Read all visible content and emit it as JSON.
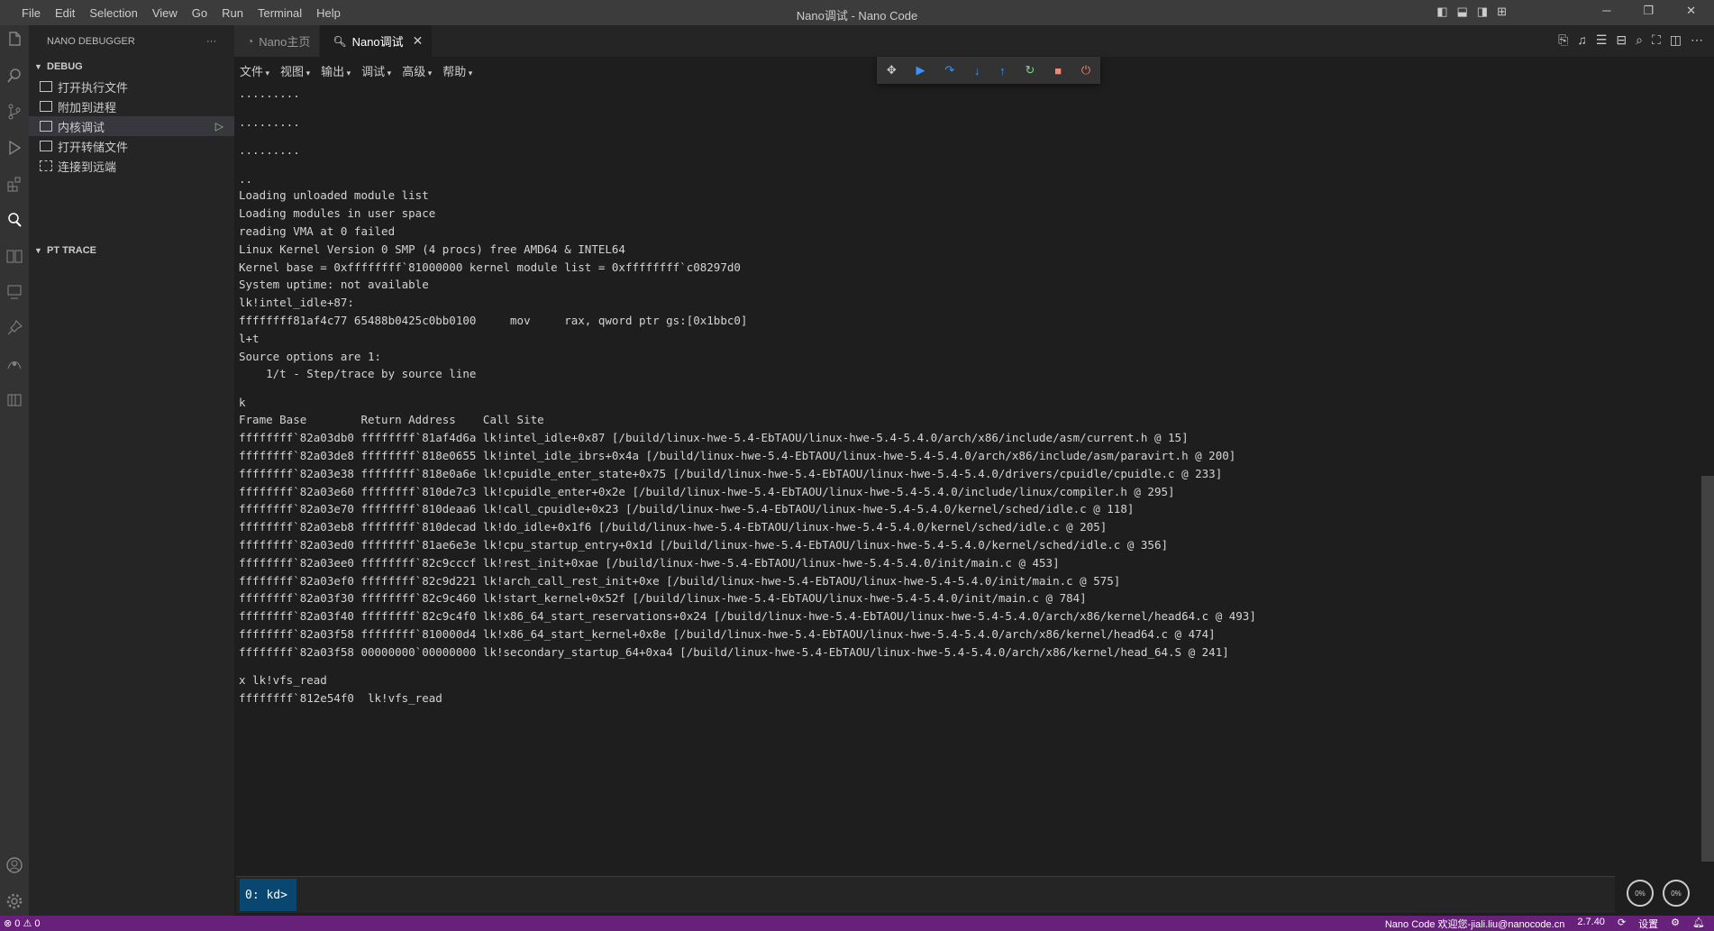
{
  "window": {
    "title": "Nano调试 - Nano Code",
    "menu": [
      "File",
      "Edit",
      "Selection",
      "View",
      "Go",
      "Run",
      "Terminal",
      "Help"
    ]
  },
  "sidebar": {
    "header": "NANO DEBUGGER",
    "more": "···",
    "debug_section": "DEBUG",
    "items": [
      "打开执行文件",
      "附加到进程",
      "内核调试",
      "打开转储文件",
      "连接到远端"
    ],
    "pt_section": "PT TRACE"
  },
  "tabs": [
    {
      "label": "Nano主页",
      "active": false
    },
    {
      "label": "Nano调试",
      "active": true
    }
  ],
  "panel_menu": [
    "文件",
    "视图",
    "输出",
    "调试",
    "高级",
    "帮助"
  ],
  "output_lines": [
    ".........",
    ".........",
    ".........",
    "..",
    "Loading unloaded module list",
    "Loading modules in user space",
    "reading VMA at 0 failed",
    "Linux Kernel Version 0 SMP (4 procs) free AMD64 & INTEL64",
    "Kernel base = 0xffffffff`81000000 kernel module list = 0xffffffff`c08297d0",
    "System uptime: not available",
    "lk!intel_idle+87:",
    "ffffffff81af4c77 65488b0425c0bb0100     mov     rax, qword ptr gs:[0x1bbc0]",
    "l+t",
    "Source options are 1:",
    "    1/t - Step/trace by source line",
    "k",
    "Frame Base        Return Address    Call Site",
    "ffffffff`82a03db0 ffffffff`81af4d6a lk!intel_idle+0x87 [/build/linux-hwe-5.4-EbTAOU/linux-hwe-5.4-5.4.0/arch/x86/include/asm/current.h @ 15]",
    "ffffffff`82a03de8 ffffffff`818e0655 lk!intel_idle_ibrs+0x4a [/build/linux-hwe-5.4-EbTAOU/linux-hwe-5.4-5.4.0/arch/x86/include/asm/paravirt.h @ 200]",
    "ffffffff`82a03e38 ffffffff`818e0a6e lk!cpuidle_enter_state+0x75 [/build/linux-hwe-5.4-EbTAOU/linux-hwe-5.4-5.4.0/drivers/cpuidle/cpuidle.c @ 233]",
    "ffffffff`82a03e60 ffffffff`810de7c3 lk!cpuidle_enter+0x2e [/build/linux-hwe-5.4-EbTAOU/linux-hwe-5.4-5.4.0/include/linux/compiler.h @ 295]",
    "ffffffff`82a03e70 ffffffff`810deaa6 lk!call_cpuidle+0x23 [/build/linux-hwe-5.4-EbTAOU/linux-hwe-5.4-5.4.0/kernel/sched/idle.c @ 118]",
    "ffffffff`82a03eb8 ffffffff`810decad lk!do_idle+0x1f6 [/build/linux-hwe-5.4-EbTAOU/linux-hwe-5.4-5.4.0/kernel/sched/idle.c @ 205]",
    "ffffffff`82a03ed0 ffffffff`81ae6e3e lk!cpu_startup_entry+0x1d [/build/linux-hwe-5.4-EbTAOU/linux-hwe-5.4-5.4.0/kernel/sched/idle.c @ 356]",
    "ffffffff`82a03ee0 ffffffff`82c9cccf lk!rest_init+0xae [/build/linux-hwe-5.4-EbTAOU/linux-hwe-5.4-5.4.0/init/main.c @ 453]",
    "ffffffff`82a03ef0 ffffffff`82c9d221 lk!arch_call_rest_init+0xe [/build/linux-hwe-5.4-EbTAOU/linux-hwe-5.4-5.4.0/init/main.c @ 575]",
    "ffffffff`82a03f30 ffffffff`82c9c460 lk!start_kernel+0x52f [/build/linux-hwe-5.4-EbTAOU/linux-hwe-5.4-5.4.0/init/main.c @ 784]",
    "ffffffff`82a03f40 ffffffff`82c9c4f0 lk!x86_64_start_reservations+0x24 [/build/linux-hwe-5.4-EbTAOU/linux-hwe-5.4-5.4.0/arch/x86/kernel/head64.c @ 493]",
    "ffffffff`82a03f58 ffffffff`810000d4 lk!x86_64_start_kernel+0x8e [/build/linux-hwe-5.4-EbTAOU/linux-hwe-5.4-5.4.0/arch/x86/kernel/head64.c @ 474]",
    "ffffffff`82a03f58 00000000`00000000 lk!secondary_startup_64+0xa4 [/build/linux-hwe-5.4-EbTAOU/linux-hwe-5.4-5.4.0/arch/x86/kernel/head_64.S @ 241]",
    "x lk!vfs_read",
    "ffffffff`812e54f0  lk!vfs_read"
  ],
  "command": {
    "prompt": "0: kd>",
    "value": ""
  },
  "gauges": [
    "0%",
    "0%"
  ],
  "status": {
    "problems": "⊗ 0 ⚠ 0",
    "welcome": "Nano Code 欢迎您-jiali.liu@nanocode.cn",
    "version": "2.7.40",
    "settings": "设置"
  }
}
